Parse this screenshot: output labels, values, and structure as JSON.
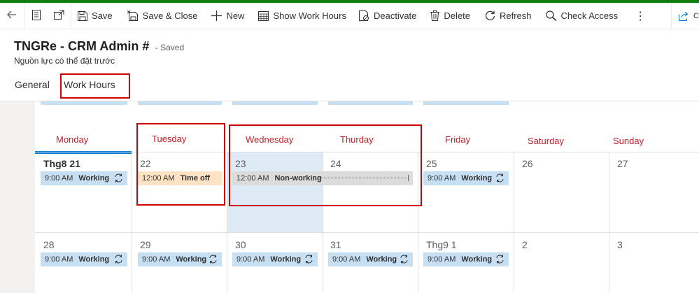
{
  "toolbar": {
    "items": [
      {
        "icon": "back-arrow-icon"
      },
      {
        "icon": "form-icon"
      },
      {
        "icon": "open-new-window-icon"
      },
      {
        "icon": "save-icon",
        "label": "Save"
      },
      {
        "icon": "save-close-icon",
        "label": "Save & Close"
      },
      {
        "icon": "plus-icon",
        "label": "New"
      },
      {
        "icon": "calendar-icon",
        "label": "Show Work Hours"
      },
      {
        "icon": "deactivate-icon",
        "label": "Deactivate"
      },
      {
        "icon": "trash-icon",
        "label": "Delete"
      },
      {
        "icon": "refresh-icon",
        "label": "Refresh"
      },
      {
        "icon": "key-search-icon",
        "label": "Check Access"
      },
      {
        "icon": "more-icon",
        "label": "⋮"
      }
    ],
    "share_partial": "C"
  },
  "record": {
    "title": "TNGRe - CRM Admin #",
    "status": "- Saved",
    "entity": "Nguồn lực có thể đặt trước"
  },
  "tabs": [
    {
      "label": "General",
      "selected": false
    },
    {
      "label": "Work Hours",
      "selected": true
    }
  ],
  "calendar": {
    "days": [
      "Monday",
      "Tuesday",
      "Wednesday",
      "Thurday",
      "Friday",
      "Saturday",
      "Sunday"
    ],
    "week1": {
      "dates": [
        "Thg8 21",
        "22",
        "23",
        "24",
        "25",
        "26",
        "27"
      ],
      "events": [
        {
          "time": "9:00 AM",
          "label": "Working",
          "type": "working"
        },
        {
          "time": "12:00 AM",
          "label": "Time off",
          "type": "off"
        },
        {
          "time": "12:00 AM",
          "label": "Non-working",
          "type": "nonworking"
        },
        {
          "time": "9:00 AM",
          "label": "Working",
          "type": "working"
        }
      ]
    },
    "week2": {
      "dates": [
        "28",
        "29",
        "30",
        "31",
        "Thg9 1",
        "2",
        "3"
      ],
      "events": [
        {
          "time": "9:00 AM",
          "label": "Working"
        },
        {
          "time": "9:00 AM",
          "label": "Working"
        },
        {
          "time": "9:00 AM",
          "label": "Working"
        },
        {
          "time": "9:00 AM",
          "label": "Working"
        },
        {
          "time": "9:00 AM",
          "label": "Working"
        }
      ]
    }
  },
  "colors": {
    "day_header": "#c0202a",
    "highlight_box": "#d00000",
    "working_event": "#c7dff3",
    "timeoff_event": "#fde2c4",
    "nonworking_event": "#dcdcdc",
    "selected_column": "#deebf7",
    "today_marker": "#0078d4"
  }
}
